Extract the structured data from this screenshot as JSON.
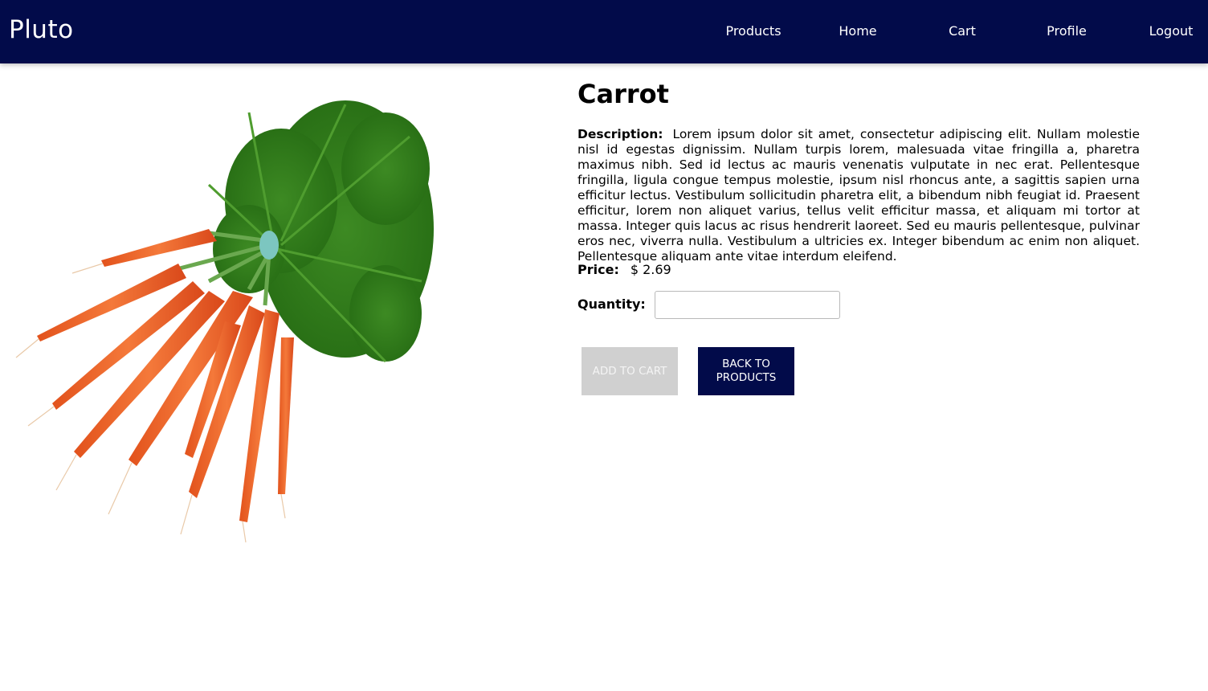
{
  "navbar": {
    "brand": "Pluto",
    "links": [
      {
        "label": "Products"
      },
      {
        "label": "Home"
      },
      {
        "label": "Cart"
      },
      {
        "label": "Profile"
      },
      {
        "label": "Logout"
      }
    ]
  },
  "colors": {
    "navbar_bg": "#020b4a",
    "primary_button": "#020b4a",
    "disabled_button": "#d0d0d0"
  },
  "product": {
    "image_icon": "carrot-bunch-image",
    "name": "Carrot",
    "description_label": "Description:",
    "description": "Lorem ipsum dolor sit amet, consectetur adipiscing elit. Nullam molestie nisl id egestas dignissim. Nullam turpis lorem, malesuada vitae fringilla a, pharetra maximus nibh. Sed id lectus ac mauris venenatis vulputate in nec erat. Pellentesque fringilla, ligula congue tempus molestie, ipsum nisl rhoncus ante, a sagittis sapien urna efficitur lectus. Vestibulum sollicitudin pharetra elit, a bibendum nibh feugiat id. Praesent efficitur, lorem non aliquet varius, tellus velit efficitur massa, et aliquam mi tortor at massa. Integer quis lacus ac risus hendrerit laoreet. Sed eu mauris pellentesque, pulvinar eros nec, viverra nulla. Vestibulum a ultricies ex. Integer bibendum ac enim non aliquet. Pellentesque aliquam ante vitae interdum eleifend.",
    "price_label": "Price:",
    "price": "$ 2.69",
    "quantity_label": "Quantity:",
    "quantity_value": "",
    "quantity_placeholder": ""
  },
  "actions": {
    "add_to_cart": "ADD TO CART",
    "back_to_products": "BACK TO PRODUCTS"
  }
}
